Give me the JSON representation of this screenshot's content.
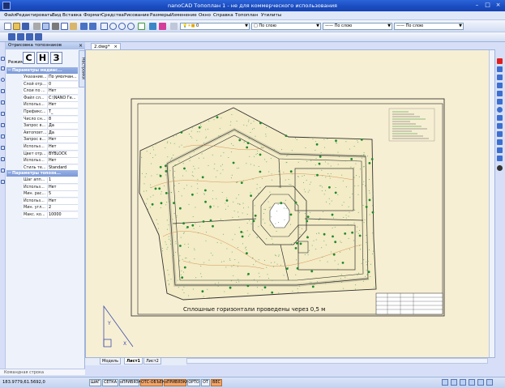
{
  "window": {
    "title": "nanoCAD Топоплан 1 - не для коммерческого использования",
    "minimize_label": "–",
    "maximize_label": "□",
    "close_label": "×"
  },
  "menu": {
    "items": [
      "Файл",
      "Редактировать",
      "Вид",
      "Вставка",
      "Формат",
      "Средства",
      "Рисование",
      "Размеры",
      "Изменение",
      "Окно",
      "Справка",
      "Топоплан",
      "Утилиты"
    ]
  },
  "toolbar": {
    "layer_value": "0",
    "linetype_value": "По слою",
    "lineweight_value": "По слою",
    "color_value": "По слою"
  },
  "panel": {
    "title": "Отрисовка топознаков",
    "side_tab": "Настройки",
    "mode_label": "Режим:",
    "mode_buttons": [
      "С",
      "Н",
      "З"
    ],
    "section1": "Параметры медиас...",
    "section1_rows": [
      {
        "name": "Указание...",
        "value": "По умолчан..."
      },
      {
        "name": "Слой отр...",
        "value": "0"
      },
      {
        "name": "Слои по ...",
        "value": "Нет"
      },
      {
        "name": "Файл сл...",
        "value": "C:\\NANO Ге..."
      },
      {
        "name": "Использ...",
        "value": "Нет"
      },
      {
        "name": "Префикс...",
        "value": "T_"
      },
      {
        "name": "Число сн...",
        "value": "8"
      },
      {
        "name": "Запрос в...",
        "value": "Да"
      },
      {
        "name": "Автоповт...",
        "value": "Да"
      },
      {
        "name": "Запрос в...",
        "value": "Нет"
      },
      {
        "name": "Использ...",
        "value": "Нет"
      },
      {
        "name": "Цвет отр...",
        "value": "BYBLOCK"
      },
      {
        "name": "Использ...",
        "value": "Нет"
      },
      {
        "name": "Стиль те...",
        "value": "Standard"
      }
    ],
    "section2": "Параметры топозн...",
    "section2_rows": [
      {
        "name": "Шаг апп...",
        "value": "1"
      },
      {
        "name": "Использ...",
        "value": "Нет"
      },
      {
        "name": "Мин. рас...",
        "value": "5"
      },
      {
        "name": "Использ...",
        "value": "Нет"
      },
      {
        "name": "Мин. угл...",
        "value": "2"
      },
      {
        "name": "Макс. ко...",
        "value": "10000"
      }
    ]
  },
  "document": {
    "tab_label": "2.dwg*",
    "tab_close": "×",
    "layout_tabs": [
      "Модель",
      "Лист1",
      "Лист2"
    ],
    "active_layout": "Лист1",
    "drawing_caption": "Сплошные горизонтали проведены через 0,5 м",
    "ucs_x": "X",
    "ucs_y": "Y"
  },
  "command_line": {
    "placeholder": "Командная строка"
  },
  "status": {
    "coords": "183.9779,61.5692,0",
    "buttons": [
      {
        "label": "ШАГ",
        "on": false
      },
      {
        "label": "СЕТКА",
        "on": false
      },
      {
        "label": "оПРИВЯЗКА",
        "on": false
      },
      {
        "label": "ОТС-ОБЪЕКТ",
        "on": true
      },
      {
        "label": "оПРИВЯЗКА",
        "on": true
      },
      {
        "label": "ОРТО",
        "on": false
      },
      {
        "label": "ОТ",
        "on": false
      },
      {
        "label": "ВЕС",
        "on": true
      }
    ]
  },
  "colors": {
    "title_bar": "#1a4cc0",
    "paper": "#f7efd3",
    "vegetation": "#1e8a2a",
    "status_on": "#f2a66b",
    "contour": "#d17a3a"
  }
}
